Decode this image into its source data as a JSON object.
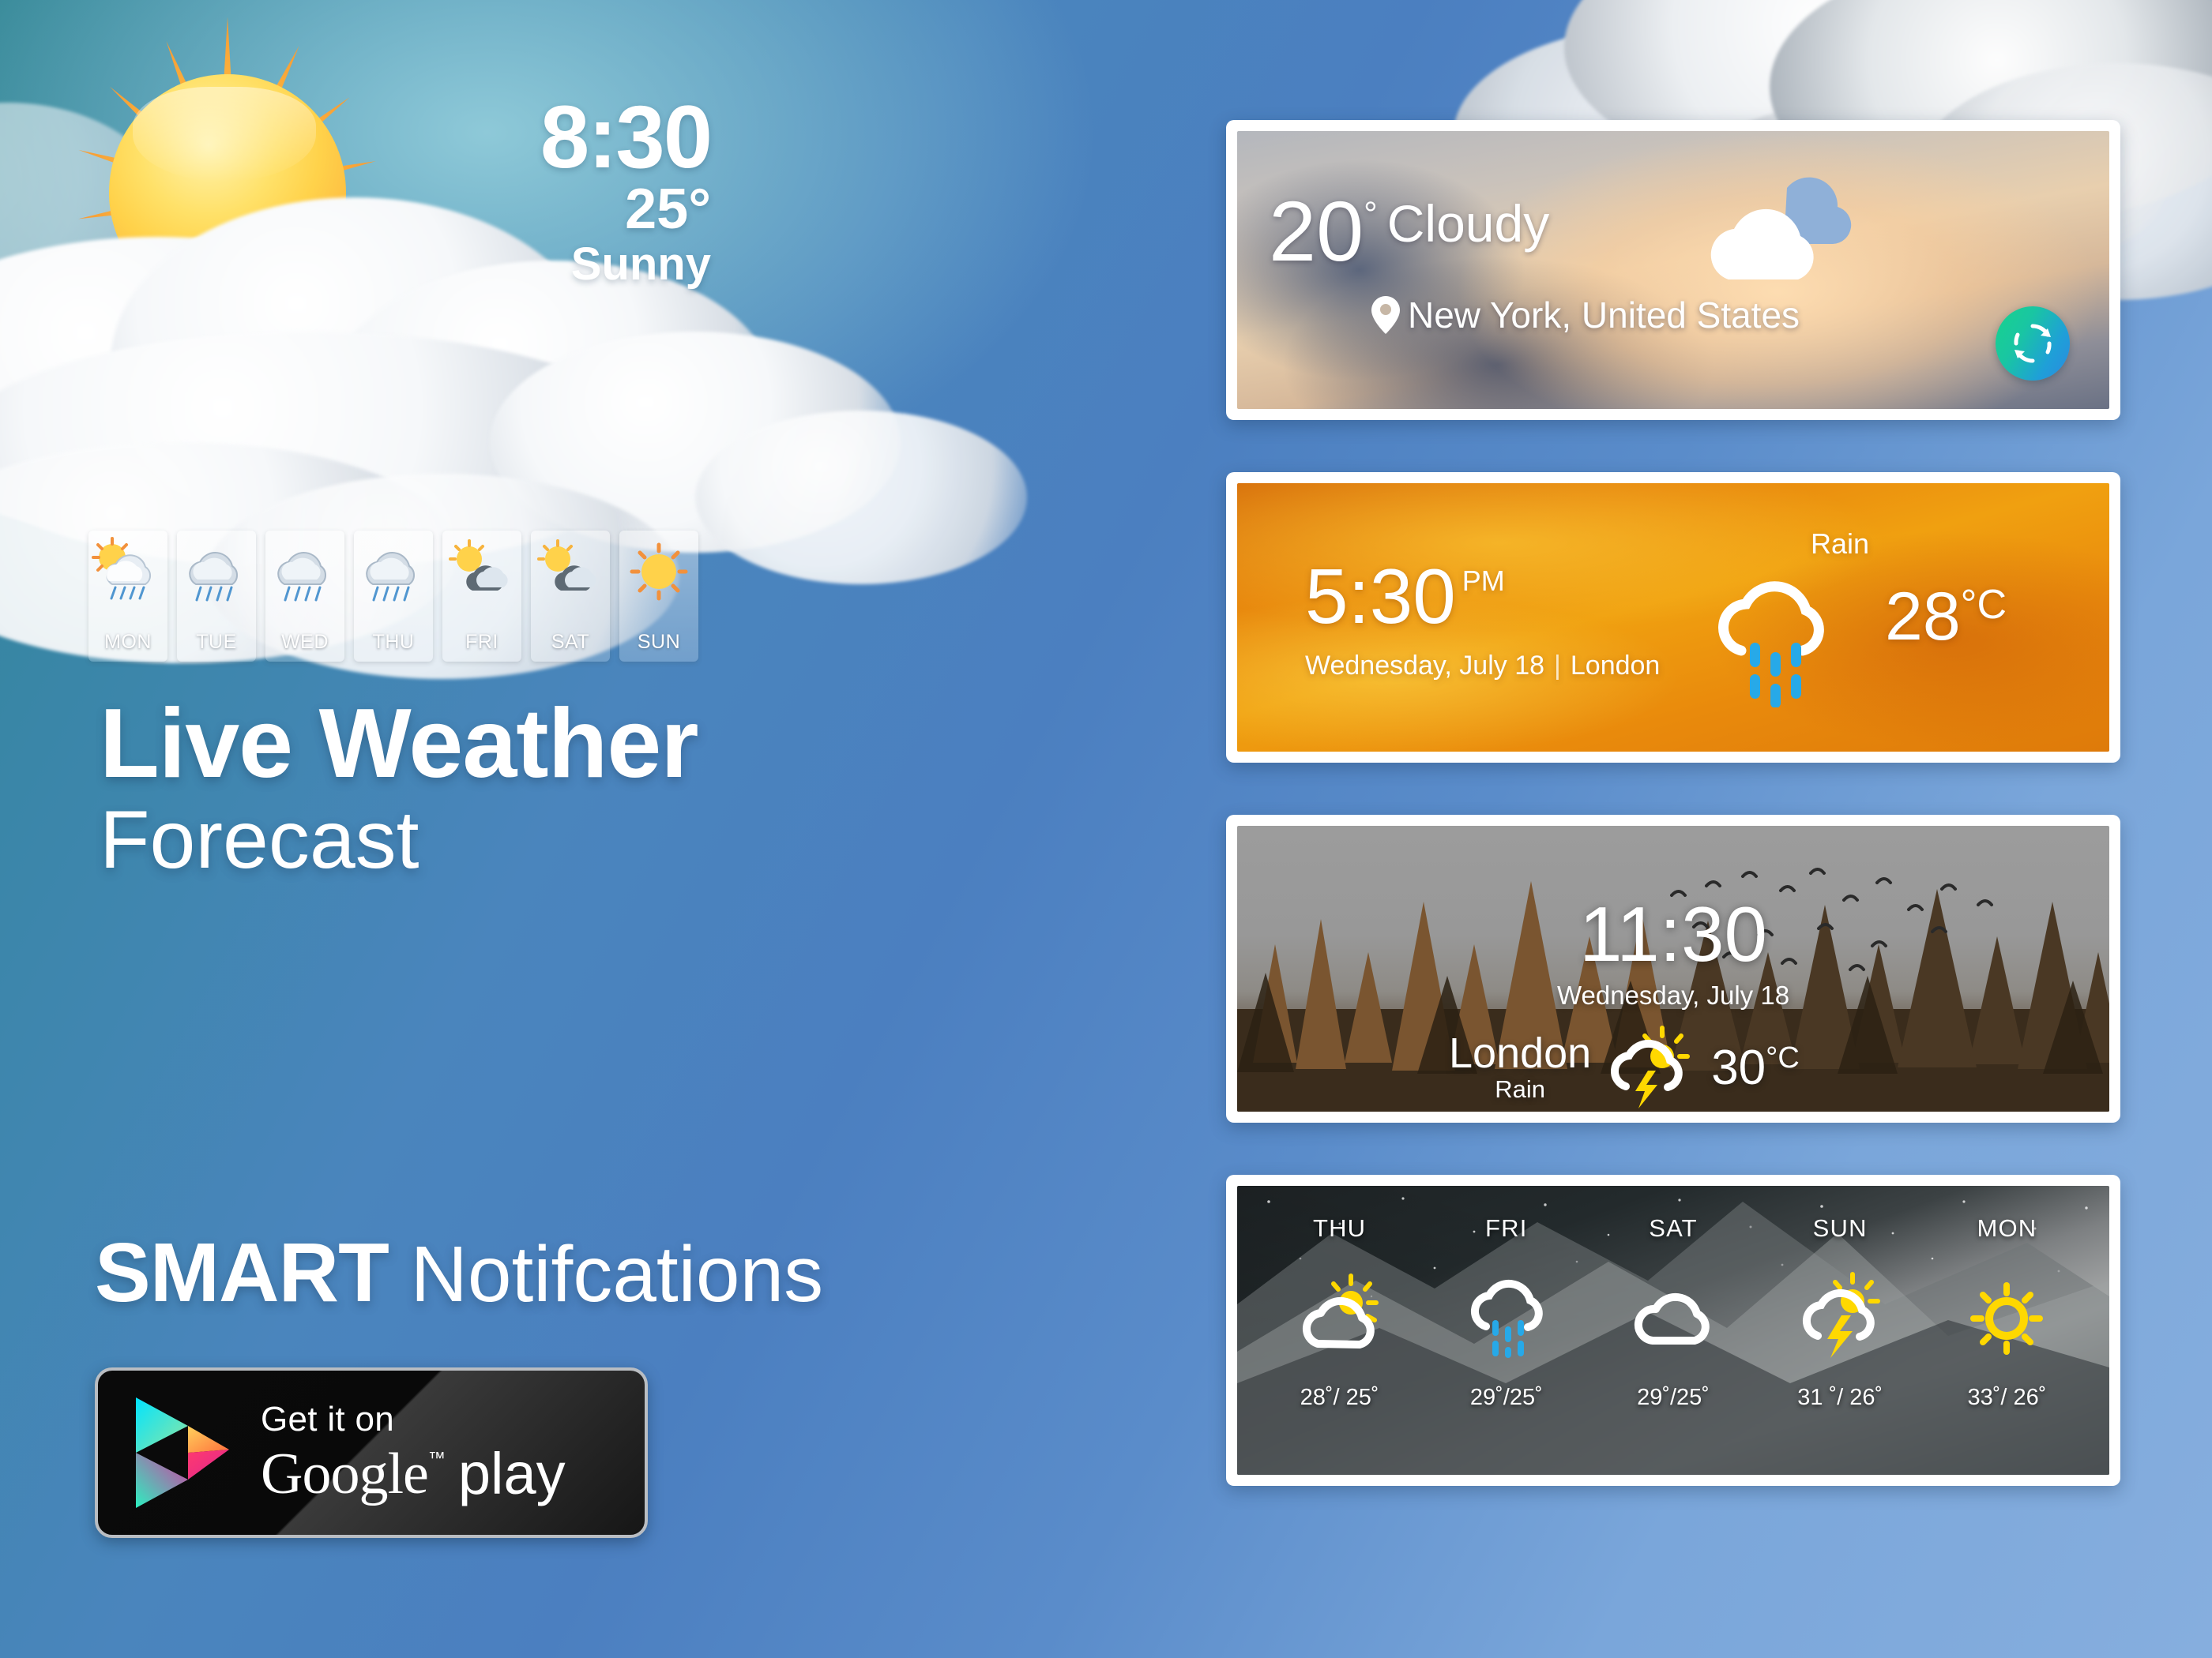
{
  "background": {
    "accent_teal": "#2f8392",
    "accent_blue": "#86aede"
  },
  "hero_panel": {
    "sun_icon": "sun-icon",
    "cloud_icon": "cloud-bank-icon",
    "time": "8:30",
    "temperature": "25°",
    "condition": "Sunny",
    "title_line1": "Live Weather",
    "title_line2": "Forecast",
    "smart_bold": "SMART",
    "smart_rest": " Notifcations"
  },
  "weekstrip": {
    "days": [
      {
        "label": "MON",
        "icon": "sun-rain-cloud-icon"
      },
      {
        "label": "TUE",
        "icon": "rain-cloud-icon"
      },
      {
        "label": "WED",
        "icon": "rain-cloud-icon"
      },
      {
        "label": "THU",
        "icon": "rain-cloud-icon"
      },
      {
        "label": "FRI",
        "icon": "sun-cloud-icon"
      },
      {
        "label": "SAT",
        "icon": "sun-cloud-icon"
      },
      {
        "label": "SUN",
        "icon": "sun-icon"
      }
    ]
  },
  "google_play": {
    "icon": "google-play-triangle-icon",
    "small_text": "Get it on",
    "brand": "Google",
    "trademark": "™",
    "store": "play"
  },
  "widgets": [
    {
      "id": "widget-cloudy-newyork",
      "temperature": "20",
      "degree_symbol": "°",
      "condition": "Cloudy",
      "location": "New York, United States",
      "location_icon": "map-pin-icon",
      "weather_icon": "cloud-icon",
      "refresh_icon": "refresh-icon",
      "refresh_gradient_from": "#18d38c",
      "refresh_gradient_to": "#2b8ae0"
    },
    {
      "id": "widget-orange-london",
      "time": "5:30",
      "meridiem": "PM",
      "date": "Wednesday, July 18",
      "separator": "|",
      "city": "London",
      "condition": "Rain",
      "weather_icon": "rain-cloud-icon",
      "temperature": "28",
      "unit": "°C",
      "background_color": "#e8880e"
    },
    {
      "id": "widget-forest-london",
      "time": "11:30",
      "date": "Wednesday, July 18",
      "city": "London",
      "condition": "Rain",
      "weather_icon": "sun-thunderstorm-icon",
      "temperature": "30",
      "unit": "°C",
      "birds_icon": "flying-birds-icon"
    },
    {
      "id": "widget-mountain-forecast",
      "days": [
        {
          "label": "THU",
          "icon": "sun-cloud-icon",
          "temps": "28˚/ 25˚"
        },
        {
          "label": "FRI",
          "icon": "rain-cloud-icon",
          "temps": "29˚/25˚"
        },
        {
          "label": "SAT",
          "icon": "cloud-icon",
          "temps": "29˚/25˚"
        },
        {
          "label": "SUN",
          "icon": "thunderstorm-sun-icon",
          "temps": "31 ˚/ 26˚"
        },
        {
          "label": "MON",
          "icon": "sun-icon",
          "temps": "33˚/ 26˚"
        }
      ]
    }
  ]
}
